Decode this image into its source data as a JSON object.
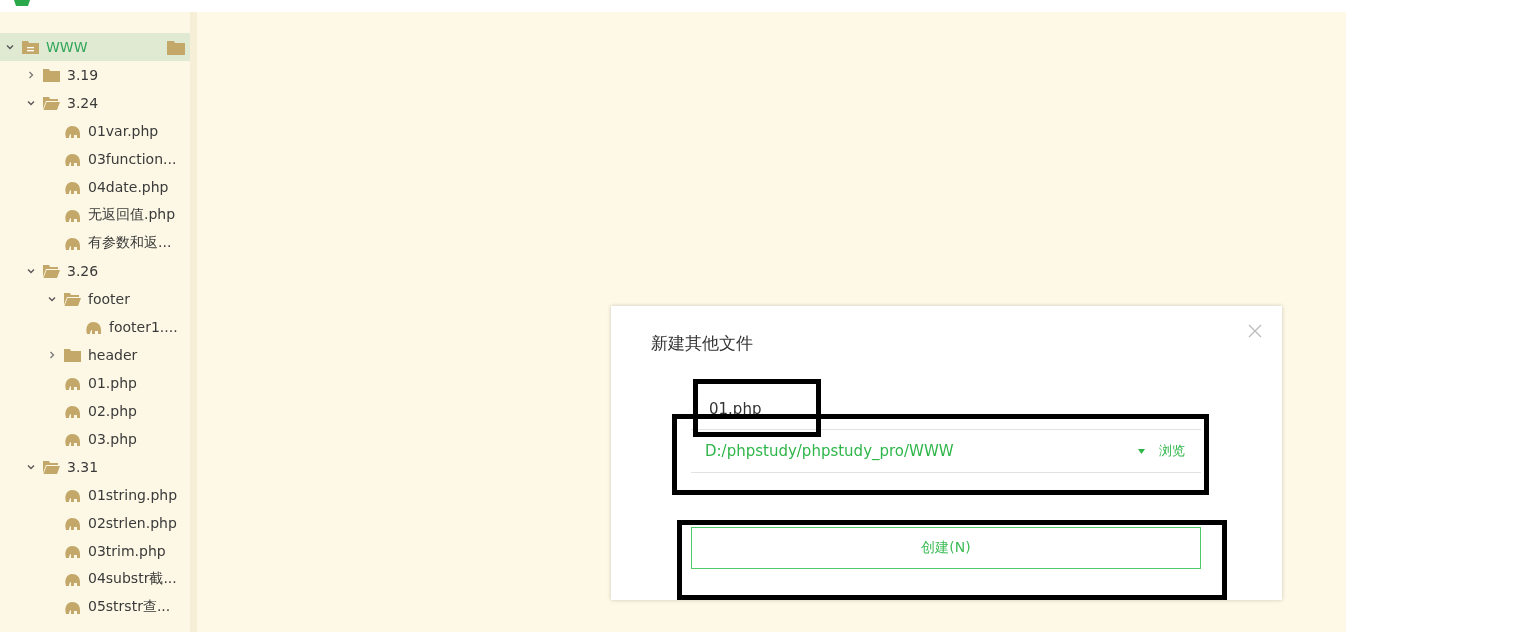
{
  "tree": [
    {
      "label": "WWW",
      "kind": "root",
      "expanded": true,
      "selected": true,
      "children": [
        {
          "label": "3.19",
          "kind": "folder",
          "expanded": false,
          "selected": false
        },
        {
          "label": "3.24",
          "kind": "folder",
          "expanded": true,
          "selected": false,
          "children": [
            {
              "label": "01var.php",
              "kind": "file",
              "selected": false
            },
            {
              "label": "03function...",
              "kind": "file",
              "selected": false
            },
            {
              "label": "04date.php",
              "kind": "file",
              "selected": false
            },
            {
              "label": "无返回值.php",
              "kind": "file",
              "selected": false
            },
            {
              "label": "有参数和返...",
              "kind": "file",
              "selected": false
            }
          ]
        },
        {
          "label": "3.26",
          "kind": "folder",
          "expanded": true,
          "selected": false,
          "children": [
            {
              "label": "footer",
              "kind": "folder",
              "expanded": true,
              "selected": false,
              "children": [
                {
                  "label": "footer1....",
                  "kind": "file",
                  "selected": false
                }
              ]
            },
            {
              "label": "header",
              "kind": "folder",
              "expanded": false,
              "selected": false
            },
            {
              "label": "01.php",
              "kind": "file",
              "selected": false
            },
            {
              "label": "02.php",
              "kind": "file",
              "selected": false
            },
            {
              "label": "03.php",
              "kind": "file",
              "selected": false
            }
          ]
        },
        {
          "label": "3.31",
          "kind": "folder",
          "expanded": true,
          "selected": false,
          "children": [
            {
              "label": "01string.php",
              "kind": "file",
              "selected": false
            },
            {
              "label": "02strlen.php",
              "kind": "file",
              "selected": false
            },
            {
              "label": "03trim.php",
              "kind": "file",
              "selected": false
            },
            {
              "label": "04substr截...",
              "kind": "file",
              "selected": false
            },
            {
              "label": "05strstr查...",
              "kind": "file",
              "selected": false
            }
          ]
        }
      ]
    }
  ],
  "dialog": {
    "title": "新建其他文件",
    "filename": "01.php",
    "path": "D:/phpstudy/phpstudy_pro/WWW",
    "browse": "浏览",
    "create_button": "创建(N)"
  }
}
